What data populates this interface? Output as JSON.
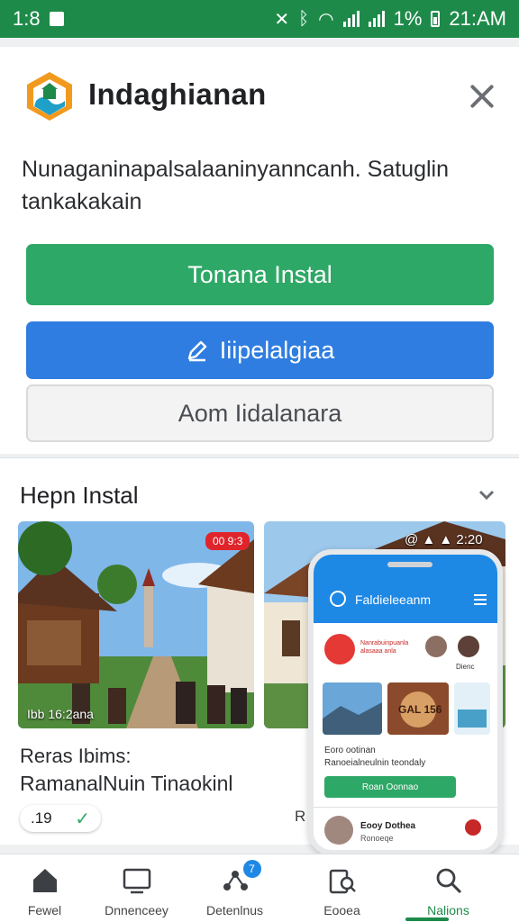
{
  "status_bar": {
    "left_time": "1:8",
    "battery_percent": "1%",
    "right_time": "21:AM"
  },
  "dialog": {
    "title": "Indaghianan",
    "description": "Nunaganinapalsalaaninyanncanh. Satuglin tankakakain",
    "install_button": "Tonana Instal",
    "edit_button": "Iiipelalgiaa",
    "add_button": "Aom Iidalanara"
  },
  "section": {
    "title": "Hepn Instal",
    "card1": {
      "badge": "00 9:3",
      "caption_overlay": "Ibb 16:2ana",
      "caption_line1": "Reras Ibims:",
      "caption_line2": "RamanalNuin Tinaokinl",
      "rating": ".19"
    },
    "card2": {
      "top_text": "@ ▲ ▲ 2:20",
      "rating": "R"
    }
  },
  "phone": {
    "title": "Faldieleeanm",
    "logo_text": "Nanrabuinpuanla alasaaa anla",
    "avatar_label": "Dienc",
    "thumb_text": "GAL 156",
    "line1": "Eoro ootinan",
    "line2": "Ranoeialneulnin teondaly",
    "button": "Roan Oonnao",
    "row_name": "Eooy Dothea",
    "row_sub": "Ronoeqe"
  },
  "bottom_nav": {
    "items": [
      {
        "label": "Fewel",
        "icon": "home-icon",
        "active": false
      },
      {
        "label": "Dnnenceey",
        "icon": "tv-icon",
        "active": false
      },
      {
        "label": "Detenlnus",
        "icon": "network-icon",
        "active": false,
        "badge": "7"
      },
      {
        "label": "Eooea",
        "icon": "book-search-icon",
        "active": false
      },
      {
        "label": "Nalions",
        "icon": "search-icon",
        "active": true
      }
    ]
  },
  "colors": {
    "status_bar": "#1e8a4a",
    "install": "#2ea866",
    "edit": "#2f7de0",
    "phone_bar": "#1e88e5"
  }
}
